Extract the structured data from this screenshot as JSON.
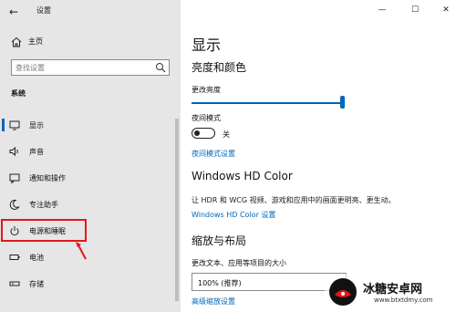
{
  "window": {
    "title": "设置",
    "back_glyph": "←",
    "minimize_glyph": "—",
    "maximize_glyph": "☐",
    "close_glyph": "✕"
  },
  "sidebar": {
    "home_label": "主页",
    "search_placeholder": "查找设置",
    "section_label": "系统",
    "items": [
      {
        "label": "显示",
        "icon": "monitor-icon",
        "selected": true
      },
      {
        "label": "声音",
        "icon": "speaker-icon"
      },
      {
        "label": "通知和操作",
        "icon": "notification-icon"
      },
      {
        "label": "专注助手",
        "icon": "moon-icon"
      },
      {
        "label": "电源和睡眠",
        "icon": "power-icon"
      },
      {
        "label": "电池",
        "icon": "battery-icon"
      },
      {
        "label": "存储",
        "icon": "storage-icon"
      }
    ]
  },
  "main": {
    "page_title": "显示",
    "brightness_section": "亮度和颜色",
    "brightness_label": "更改亮度",
    "brightness_value": 1.0,
    "night_mode_label": "夜间模式",
    "night_mode_state": "关",
    "night_mode_settings_link": "夜间模式设置",
    "hd_color_title": "Windows HD Color",
    "hd_color_desc": "让 HDR 和 WCG 视频、游戏和应用中的画面更明亮、更生动。",
    "hd_color_link": "Windows HD Color 设置",
    "scale_section": "缩放与布局",
    "scale_label": "更改文本、应用等项目的大小",
    "scale_value": "100% (推荐)",
    "advanced_scale_link": "高级缩放设置"
  },
  "watermark": {
    "name": "冰糖安卓网",
    "url": "www.btxtdmy.com"
  },
  "colors": {
    "accent": "#0067b8",
    "highlight": "#e4161b",
    "sidebar_bg": "#e6e6e6"
  }
}
